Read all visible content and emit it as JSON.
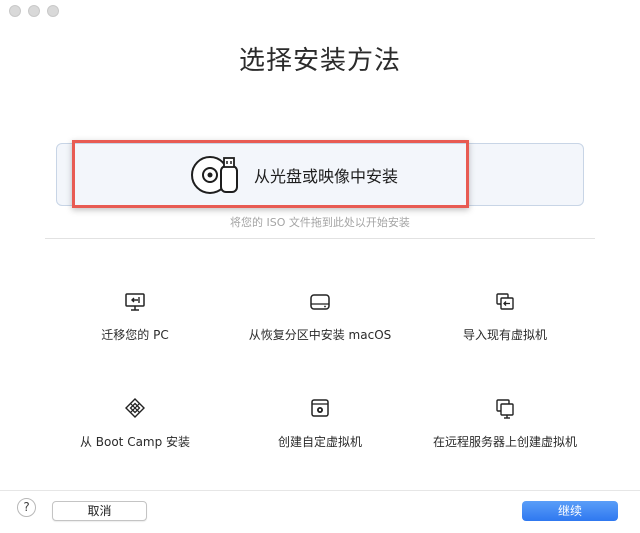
{
  "window": {
    "title": "选择安装方法",
    "traffic_lights": [
      "close",
      "minimize",
      "zoom"
    ]
  },
  "drop_zone": {
    "install_label": "从光盘或映像中安装",
    "install_icon": "disc-usb-icon",
    "hint": "将您的 ISO 文件拖到此处以开始安装"
  },
  "options": [
    {
      "label": "迁移您的 PC",
      "icon": "monitor-migrate-icon"
    },
    {
      "label": "从恢复分区中安装 macOS",
      "icon": "drive-icon"
    },
    {
      "label": "导入现有虚拟机",
      "icon": "import-vm-icon"
    },
    {
      "label": "从 Boot Camp 安装",
      "icon": "bootcamp-icon"
    },
    {
      "label": "创建自定虚拟机",
      "icon": "custom-vm-icon"
    },
    {
      "label": "在远程服务器上创建虚拟机",
      "icon": "remote-server-icon"
    }
  ],
  "footer": {
    "help": "?",
    "cancel": "取消",
    "continue": "继续"
  },
  "colors": {
    "accent": "#3b82f6",
    "highlight": "#e85b53"
  }
}
